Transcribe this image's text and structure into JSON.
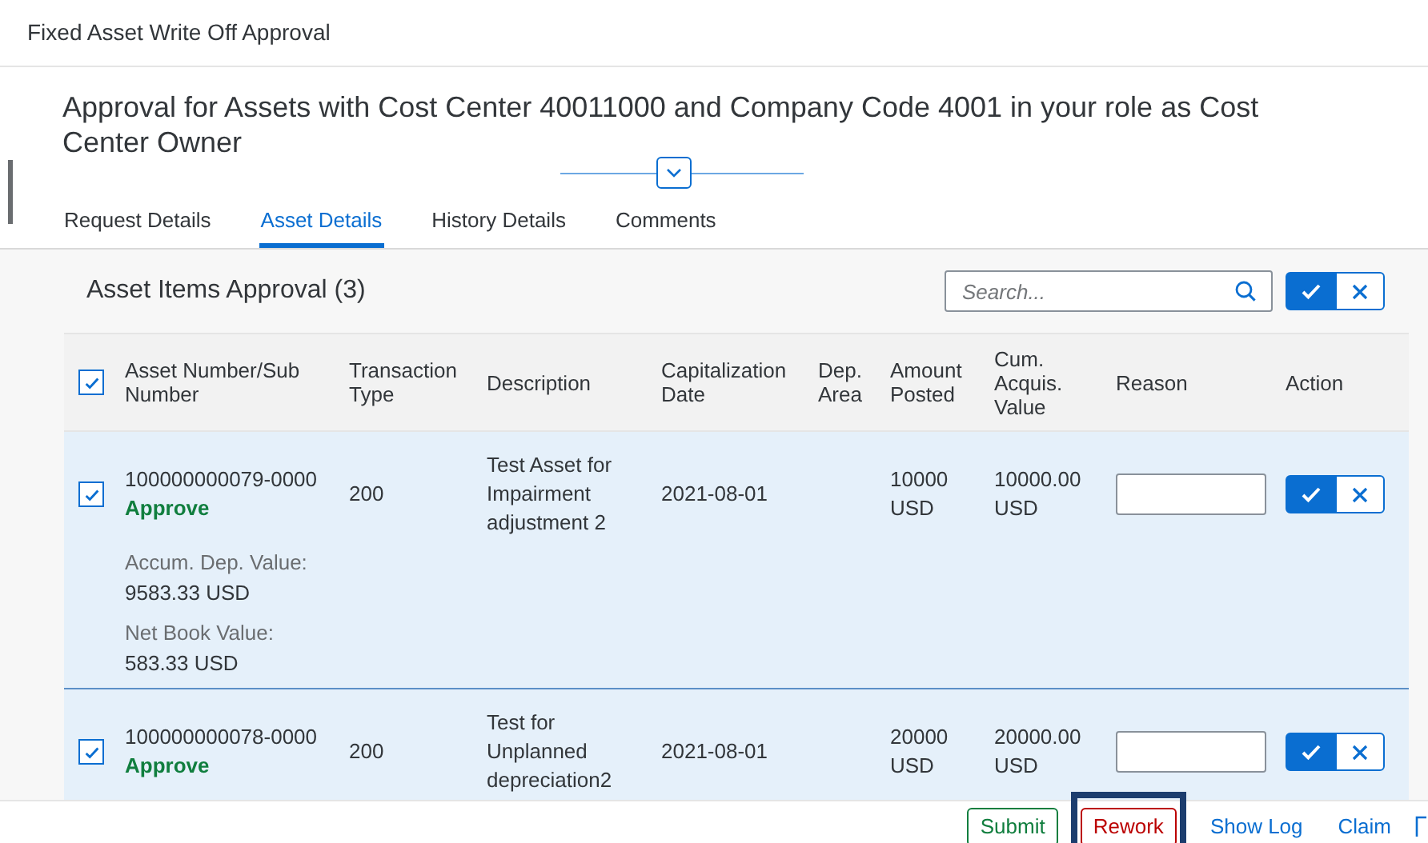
{
  "app_title": "Fixed Asset Write Off Approval",
  "header": {
    "title": "Approval for Assets with Cost Center 40011000 and Company Code 4001 in your role as Cost Center Owner",
    "expanded": false
  },
  "tabs": [
    {
      "label": "Request Details",
      "selected": false
    },
    {
      "label": "Asset Details",
      "selected": true
    },
    {
      "label": "History Details",
      "selected": false
    },
    {
      "label": "Comments",
      "selected": false
    }
  ],
  "table": {
    "title": "Asset Items Approval (3)",
    "search": {
      "placeholder": "Search..."
    },
    "select_all": {
      "checked": true
    },
    "columns": [
      "Asset Number/Sub Number",
      "Transaction Type",
      "Description",
      "Capitalization Date",
      "Dep. Area",
      "Amount Posted",
      "Cum. Acquis. Value",
      "Reason",
      "Action"
    ],
    "rows": [
      {
        "selected": true,
        "checked": true,
        "asset": "100000000079-0000",
        "status": "Approve",
        "type": "200",
        "description": "Test Asset for Impairment adjustment 2",
        "date": "2021-08-01",
        "amount": "10000 USD",
        "cum_value": "10000.00 USD",
        "details": [
          {
            "label": "Accum. Dep. Value:",
            "value": "9583.33 USD"
          },
          {
            "label": "Net Book Value:",
            "value": "583.33 USD"
          }
        ]
      },
      {
        "selected": true,
        "checked": true,
        "asset": "100000000078-0000",
        "status": "Approve",
        "type": "200",
        "description": "Test for Unplanned depreciation2",
        "date": "2021-08-01",
        "amount": "20000 USD",
        "cum_value": "20000.00 USD",
        "details": []
      }
    ]
  },
  "footer": {
    "buttons": [
      {
        "label": "Submit",
        "kind": "accept",
        "highlighted": false
      },
      {
        "label": "Rework",
        "kind": "reject",
        "highlighted": true
      },
      {
        "label": "Show Log",
        "kind": "link",
        "highlighted": false
      },
      {
        "label": "Claim",
        "kind": "link",
        "highlighted": false
      }
    ]
  }
}
